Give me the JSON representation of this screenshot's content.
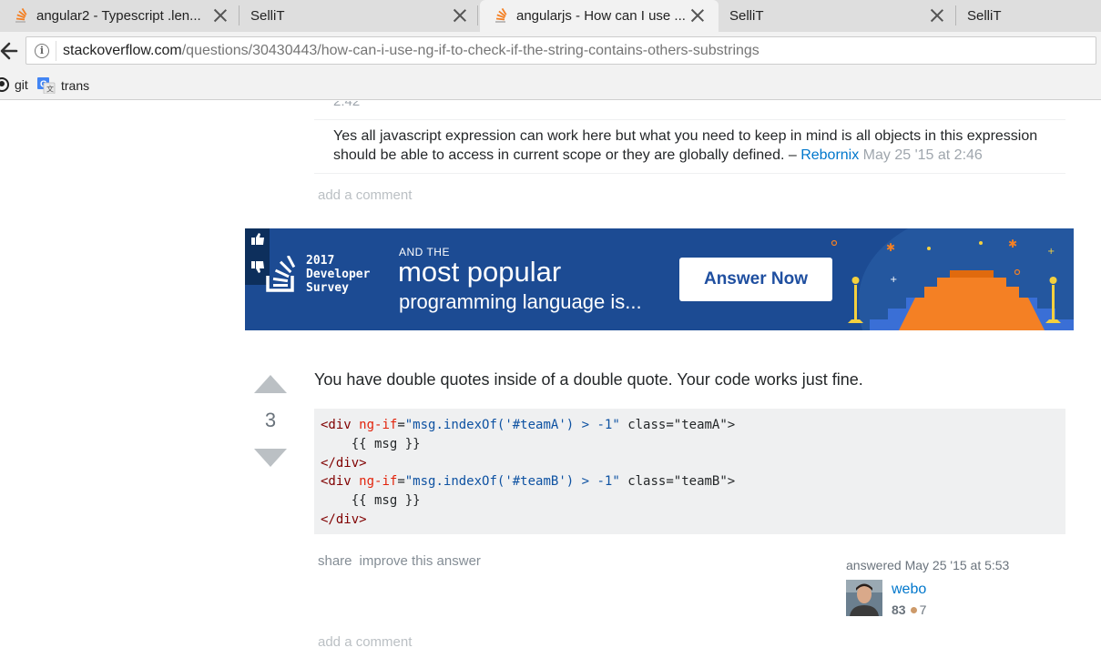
{
  "browser": {
    "tabs": [
      {
        "title": "angular2 - Typescript .len...",
        "favicon": "stackoverflow-icon",
        "active": false
      },
      {
        "title": "SelliT",
        "favicon": "",
        "active": false
      },
      {
        "title": "angularjs - How can I use ...",
        "favicon": "stackoverflow-icon",
        "active": true
      },
      {
        "title": "SelliT",
        "favicon": "",
        "active": false
      },
      {
        "title": "SelliT",
        "favicon": "",
        "active": false
      }
    ],
    "url_host": "stackoverflow.com",
    "url_path": "/questions/30430443/how-can-i-use-ng-if-to-check-if-the-string-contains-others-substrings",
    "bookmarks": [
      {
        "label": "git",
        "icon": "github-icon"
      },
      {
        "label": "trans",
        "icon": "google-translate-icon"
      }
    ]
  },
  "page": {
    "prev_comment_time": "2:42",
    "comment": {
      "text": "Yes all javascript expression can work here but what you need to keep in mind is all objects in this expression should be able to access in current scope or they are globally defined. – ",
      "user": "Rebornix",
      "date": " May 25 '15 at 2:46"
    },
    "add_comment_label": "add a comment",
    "ad": {
      "year": "2017",
      "line1": "Developer",
      "line2": "Survey",
      "and_the": "AND THE",
      "headline": "most popular",
      "subline": "programming language is...",
      "button": "Answer Now"
    },
    "answer": {
      "votes": "3",
      "text": "You have double quotes inside of a double quote. Your code works just fine.",
      "code_lines": [
        "<div ng-if=\"msg.indexOf('#teamA') > -1\" class=\"teamA\">",
        "    {{ msg }}",
        "</div>",
        "<div ng-if=\"msg.indexOf('#teamB') > -1\" class=\"teamB\">",
        "    {{ msg }}",
        "</div>"
      ],
      "share_label": "share",
      "improve_label": "improve this answer",
      "answered_label": "answered May 25 '15 at 5:53",
      "user_name": "webo",
      "user_rep": "83",
      "bronze_badges": "7"
    }
  }
}
